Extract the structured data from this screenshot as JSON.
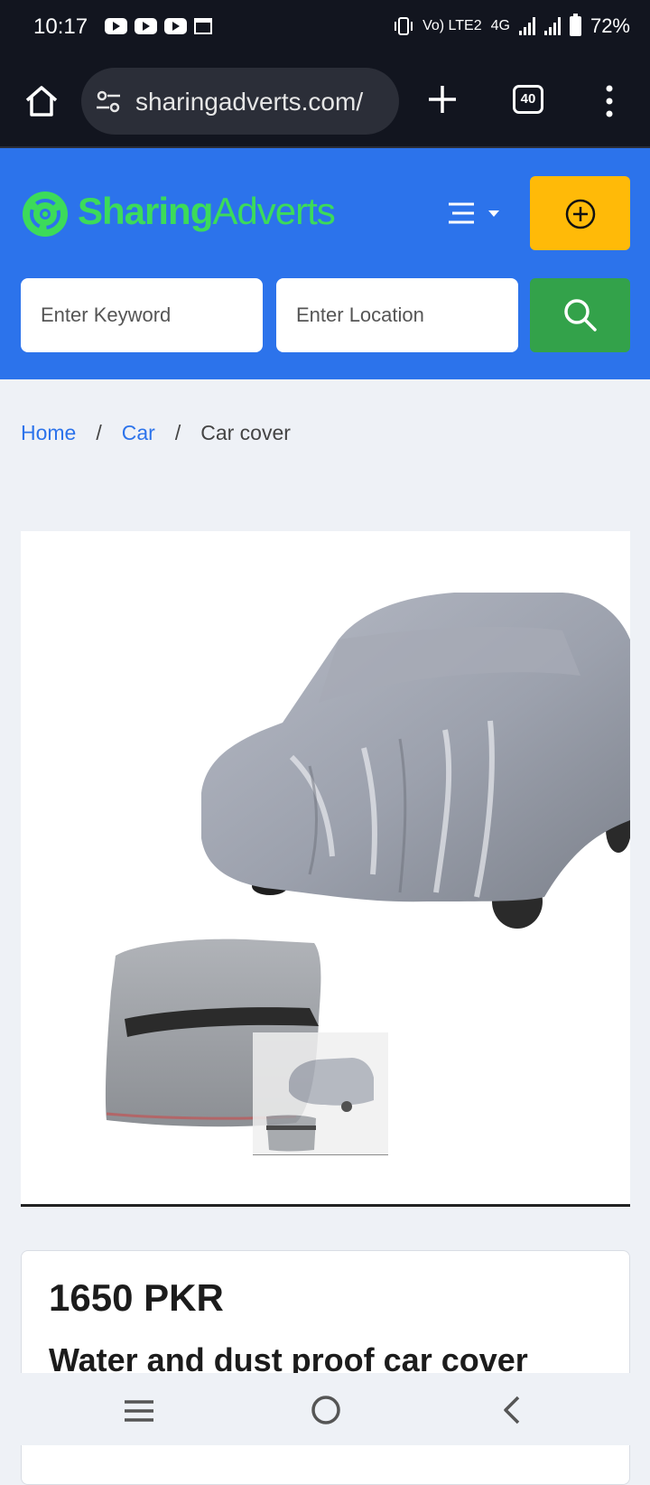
{
  "status_bar": {
    "time": "10:17",
    "network": "4G",
    "volte": "Vo) LTE2",
    "battery": "72%"
  },
  "browser": {
    "url": "sharingadverts.com/",
    "tab_count": "40"
  },
  "header": {
    "logo_part1": "Sharing",
    "logo_part2": "Adverts",
    "keyword_placeholder": "Enter Keyword",
    "location_placeholder": "Enter Location",
    "brand_color": "#2c73eb",
    "logo_color": "#3cdb5a",
    "post_button_color": "#ffba08",
    "search_button_color": "#33a24a"
  },
  "breadcrumb": {
    "items": [
      "Home",
      "Car",
      "Car cover"
    ]
  },
  "listing": {
    "price": "1650 PKR",
    "title": "Water and dust proof car cover"
  },
  "icons": {
    "status_left": [
      "youtube-icon",
      "youtube-icon",
      "youtube-icon",
      "calendar-icon"
    ],
    "toolbar": [
      "home-icon",
      "site-settings-icon",
      "plus-icon",
      "tabs-icon",
      "more-vert-icon"
    ],
    "header": [
      "menu-icon",
      "add-circle-icon",
      "search-icon"
    ],
    "system_nav": [
      "recents-icon",
      "home-circle-icon",
      "back-icon"
    ]
  }
}
